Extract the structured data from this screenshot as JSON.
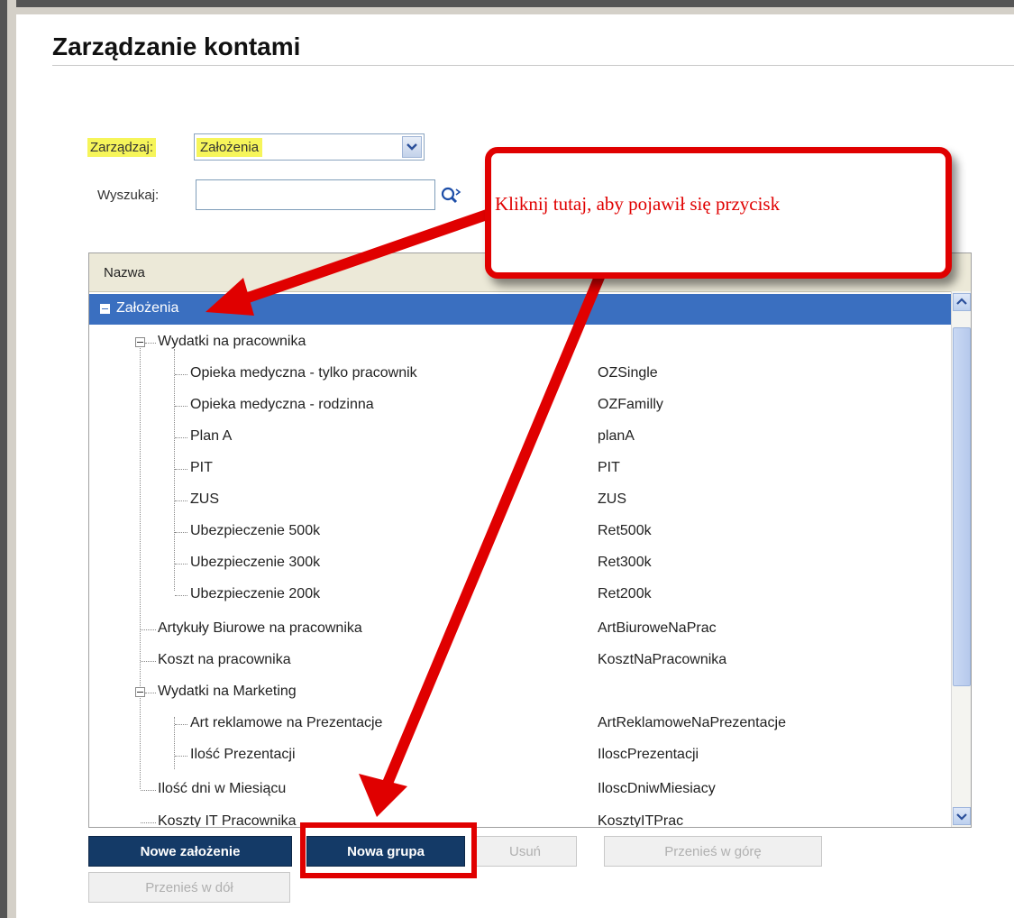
{
  "page": {
    "title": "Zarządzanie kontami"
  },
  "filter": {
    "manage_label": "Zarządzaj:",
    "manage_value": "Założenia",
    "search_label": "Wyszukaj:",
    "search_value": ""
  },
  "grid": {
    "header": "Nazwa",
    "rows": [
      {
        "name": "Założenia",
        "code": ""
      },
      {
        "name": "Wydatki na pracownika",
        "code": ""
      },
      {
        "name": "Opieka medyczna - tylko pracownik",
        "code": "OZSingle"
      },
      {
        "name": "Opieka medyczna - rodzinna",
        "code": "OZFamilly"
      },
      {
        "name": "Plan A",
        "code": "planA"
      },
      {
        "name": "PIT",
        "code": "PIT"
      },
      {
        "name": "ZUS",
        "code": "ZUS"
      },
      {
        "name": "Ubezpieczenie 500k",
        "code": "Ret500k"
      },
      {
        "name": "Ubezpieczenie 300k",
        "code": "Ret300k"
      },
      {
        "name": "Ubezpieczenie 200k",
        "code": "Ret200k"
      },
      {
        "name": "Artykuły Biurowe na pracownika",
        "code": "ArtBiuroweNaPrac"
      },
      {
        "name": "Koszt na pracownika",
        "code": "KosztNaPracownika"
      },
      {
        "name": "Wydatki na Marketing",
        "code": ""
      },
      {
        "name": "Art reklamowe na Prezentacje",
        "code": "ArtReklamoweNaPrezentacje"
      },
      {
        "name": "Ilość Prezentacji",
        "code": "IloscPrezentacji"
      },
      {
        "name": "Ilość dni w Miesiącu",
        "code": "IloscDniwMiesiacy"
      },
      {
        "name": "Koszty IT Pracownika",
        "code": "KosztyITPrac"
      }
    ]
  },
  "buttons": {
    "new_assumption": "Nowe założenie",
    "new_group": "Nowa grupa",
    "delete": "Usuń",
    "move_up": "Przenieś w górę",
    "move_down": "Przenieś w dół"
  },
  "annotation": {
    "callout_text": "Kliknij tutaj, aby pojawił się przycisk",
    "color": "#e00000"
  },
  "colors": {
    "selection": "#3a6fc0",
    "button_dark": "#143a67",
    "highlight": "#f6f55a"
  }
}
